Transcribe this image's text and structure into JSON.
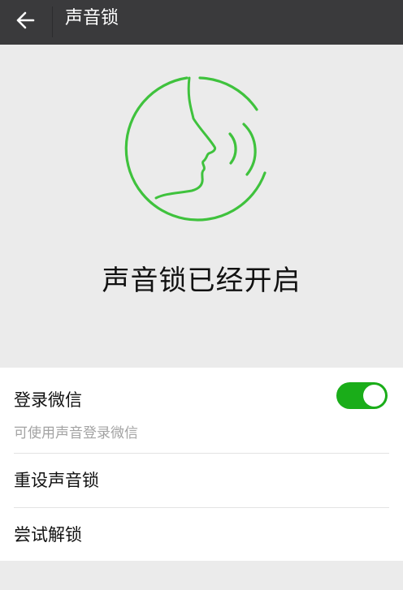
{
  "header": {
    "title": "声音锁",
    "back_icon": "back-arrow-icon"
  },
  "hero": {
    "illustration": "voice-face-icon",
    "status": "声音锁已经开启",
    "accent_color": "#3fc23d"
  },
  "settings": {
    "login": {
      "label": "登录微信",
      "subtitle": "可使用声音登录微信",
      "enabled": true,
      "toggle_color": "#1aad19"
    },
    "items": [
      {
        "label": "重设声音锁"
      },
      {
        "label": "尝试解锁"
      }
    ]
  }
}
